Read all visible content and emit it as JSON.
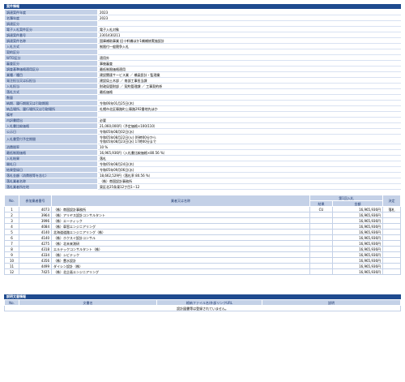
{
  "info": {
    "header": "案件情報",
    "rows": [
      {
        "label": "調達案件年度",
        "lines": [
          "2023"
        ]
      },
      {
        "label": "名簿年度",
        "lines": [
          "2023"
        ]
      },
      {
        "label": "調達区分",
        "lines": [
          ""
        ]
      },
      {
        "label": "電子入札案件区分",
        "lines": [
          "電子入札対象"
        ]
      },
      {
        "label": "調達案件番号",
        "lines": [
          "2301430211"
        ]
      },
      {
        "label": "調達案件名称",
        "lines": [
          "国庫補助事業 旧十軒橋ほか1橋補修実施設計"
        ]
      },
      {
        "label": "入札方式",
        "lines": [
          "制限付一般競争入札"
        ]
      },
      {
        "label": "契約区分",
        "lines": [
          ""
        ]
      },
      {
        "label": "WTO区分",
        "lines": [
          "適用外"
        ]
      },
      {
        "label": "審査区分",
        "lines": [
          "事後審査"
        ]
      },
      {
        "label": "調査基準価格適用区分",
        "lines": [
          "最低制限価格適用"
        ]
      },
      {
        "label": "業種／種目",
        "lines": [
          "建設関連サービス業 ／ 橋梁設計・監理業"
        ]
      },
      {
        "label": "発注担当又は伝担当",
        "lines": [
          "建設局土木部 ／ 南部工事担当課"
        ]
      },
      {
        "label": "入札担当",
        "lines": [
          "財政局管財部 ／ 契約管理課 ／ 工事契約係"
        ]
      },
      {
        "label": "落札方式",
        "lines": [
          "最低価格"
        ]
      },
      {
        "label": "数量",
        "lines": [
          ""
        ]
      },
      {
        "label": "納期、履行期限又は引取期限",
        "lines": [
          "令和06年01月25日(木)"
        ]
      },
      {
        "label": "納品場所、履行場所又は引取場所",
        "lines": [
          "札幌市北区篠路町上篠路292番地先ほか"
        ]
      },
      {
        "label": "備考",
        "lines": [
          ""
        ]
      },
      {
        "label": "内訳書提出",
        "lines": [
          "必要"
        ]
      },
      {
        "label": "入札書比較価格",
        "lines": [
          "21,060,000円（予定価格×100/110）"
        ]
      },
      {
        "label": "公示日",
        "lines": [
          "令和05年08月02日(水)"
        ]
      },
      {
        "label": "入札書受付予定期間",
        "lines": [
          "令和05年08月22日(火) 09時00分から",
          "令和05年08月23日(水) 17時00分まで"
        ]
      },
      {
        "label": "消費税率",
        "lines": [
          "10 %"
        ]
      },
      {
        "label": "最低制限価格",
        "lines": [
          "16,965,936円（入札書比較価格×80.56 %）"
        ]
      },
      {
        "label": "入札結果",
        "lines": [
          "落札"
        ]
      },
      {
        "label": "開札日",
        "lines": [
          "令和05年08月24日(木)"
        ]
      },
      {
        "label": "結果登録日",
        "lines": [
          "令和05年09月06日(水)"
        ]
      },
      {
        "label": "落札金額（消費税等を含む）",
        "lines": [
          "18,662,529円（落札率 80.56 %）"
        ]
      },
      {
        "label": "落札業者名称",
        "lines": [
          "（株）帯国設計事務所"
        ]
      },
      {
        "label": "落札業者所在地",
        "lines": [
          "東区北25条東12丁目1−12"
        ]
      }
    ]
  },
  "bids": {
    "headers": {
      "no": "No.",
      "code": "参加業者番号",
      "name": "業者又は名称",
      "round": "第1回入札",
      "result": "結果",
      "amount": "金額",
      "decision": "決定"
    },
    "rows": [
      {
        "no": "1",
        "code": "4073",
        "name": "（株）帯国設計事務所",
        "result": "CU",
        "amount": "16,965,936円",
        "decision": "落札"
      },
      {
        "no": "2",
        "code": "3964",
        "name": "（株）アリヤス設計コンサルタント",
        "result": "",
        "amount": "16,965,936円",
        "decision": ""
      },
      {
        "no": "3",
        "code": "3996",
        "name": "（株）エーティック",
        "result": "",
        "amount": "16,965,936円",
        "decision": ""
      },
      {
        "no": "4",
        "code": "4084",
        "name": "（株）車窓エンジニアリング",
        "result": "",
        "amount": "16,965,936円",
        "decision": ""
      },
      {
        "no": "5",
        "code": "4140",
        "name": "北海道道路エンジニアリング（株）",
        "result": "",
        "amount": "16,965,936円",
        "decision": ""
      },
      {
        "no": "6",
        "code": "4140",
        "name": "（株）ホクスイ設計コンサル",
        "result": "",
        "amount": "16,965,936円",
        "decision": ""
      },
      {
        "no": "7",
        "code": "4275",
        "name": "（株）北未来測研",
        "result": "",
        "amount": "16,965,936円",
        "decision": ""
      },
      {
        "no": "8",
        "code": "4318",
        "name": "エルテックコンサルタント（株）",
        "result": "",
        "amount": "16,965,936円",
        "decision": ""
      },
      {
        "no": "9",
        "code": "4334",
        "name": "（株）シビテック",
        "result": "",
        "amount": "16,965,936円",
        "decision": ""
      },
      {
        "no": "10",
        "code": "4356",
        "name": "（株）豊水設計",
        "result": "",
        "amount": "16,965,936円",
        "decision": ""
      },
      {
        "no": "11",
        "code": "4499",
        "name": "ダイシン設計（株）",
        "result": "",
        "amount": "16,965,936円",
        "decision": ""
      },
      {
        "no": "12",
        "code": "7425",
        "name": "（株）北企画エンジニアリング",
        "result": "",
        "amount": "16,965,936円",
        "decision": ""
      }
    ]
  },
  "docs": {
    "header": "説明文書情報",
    "col_no": "No.",
    "col_name": "文書名",
    "col_file": "格納ファイル名/外部リンクURL",
    "col_desc": "説明",
    "empty_message": "設計図書等は登録されていません。"
  }
}
